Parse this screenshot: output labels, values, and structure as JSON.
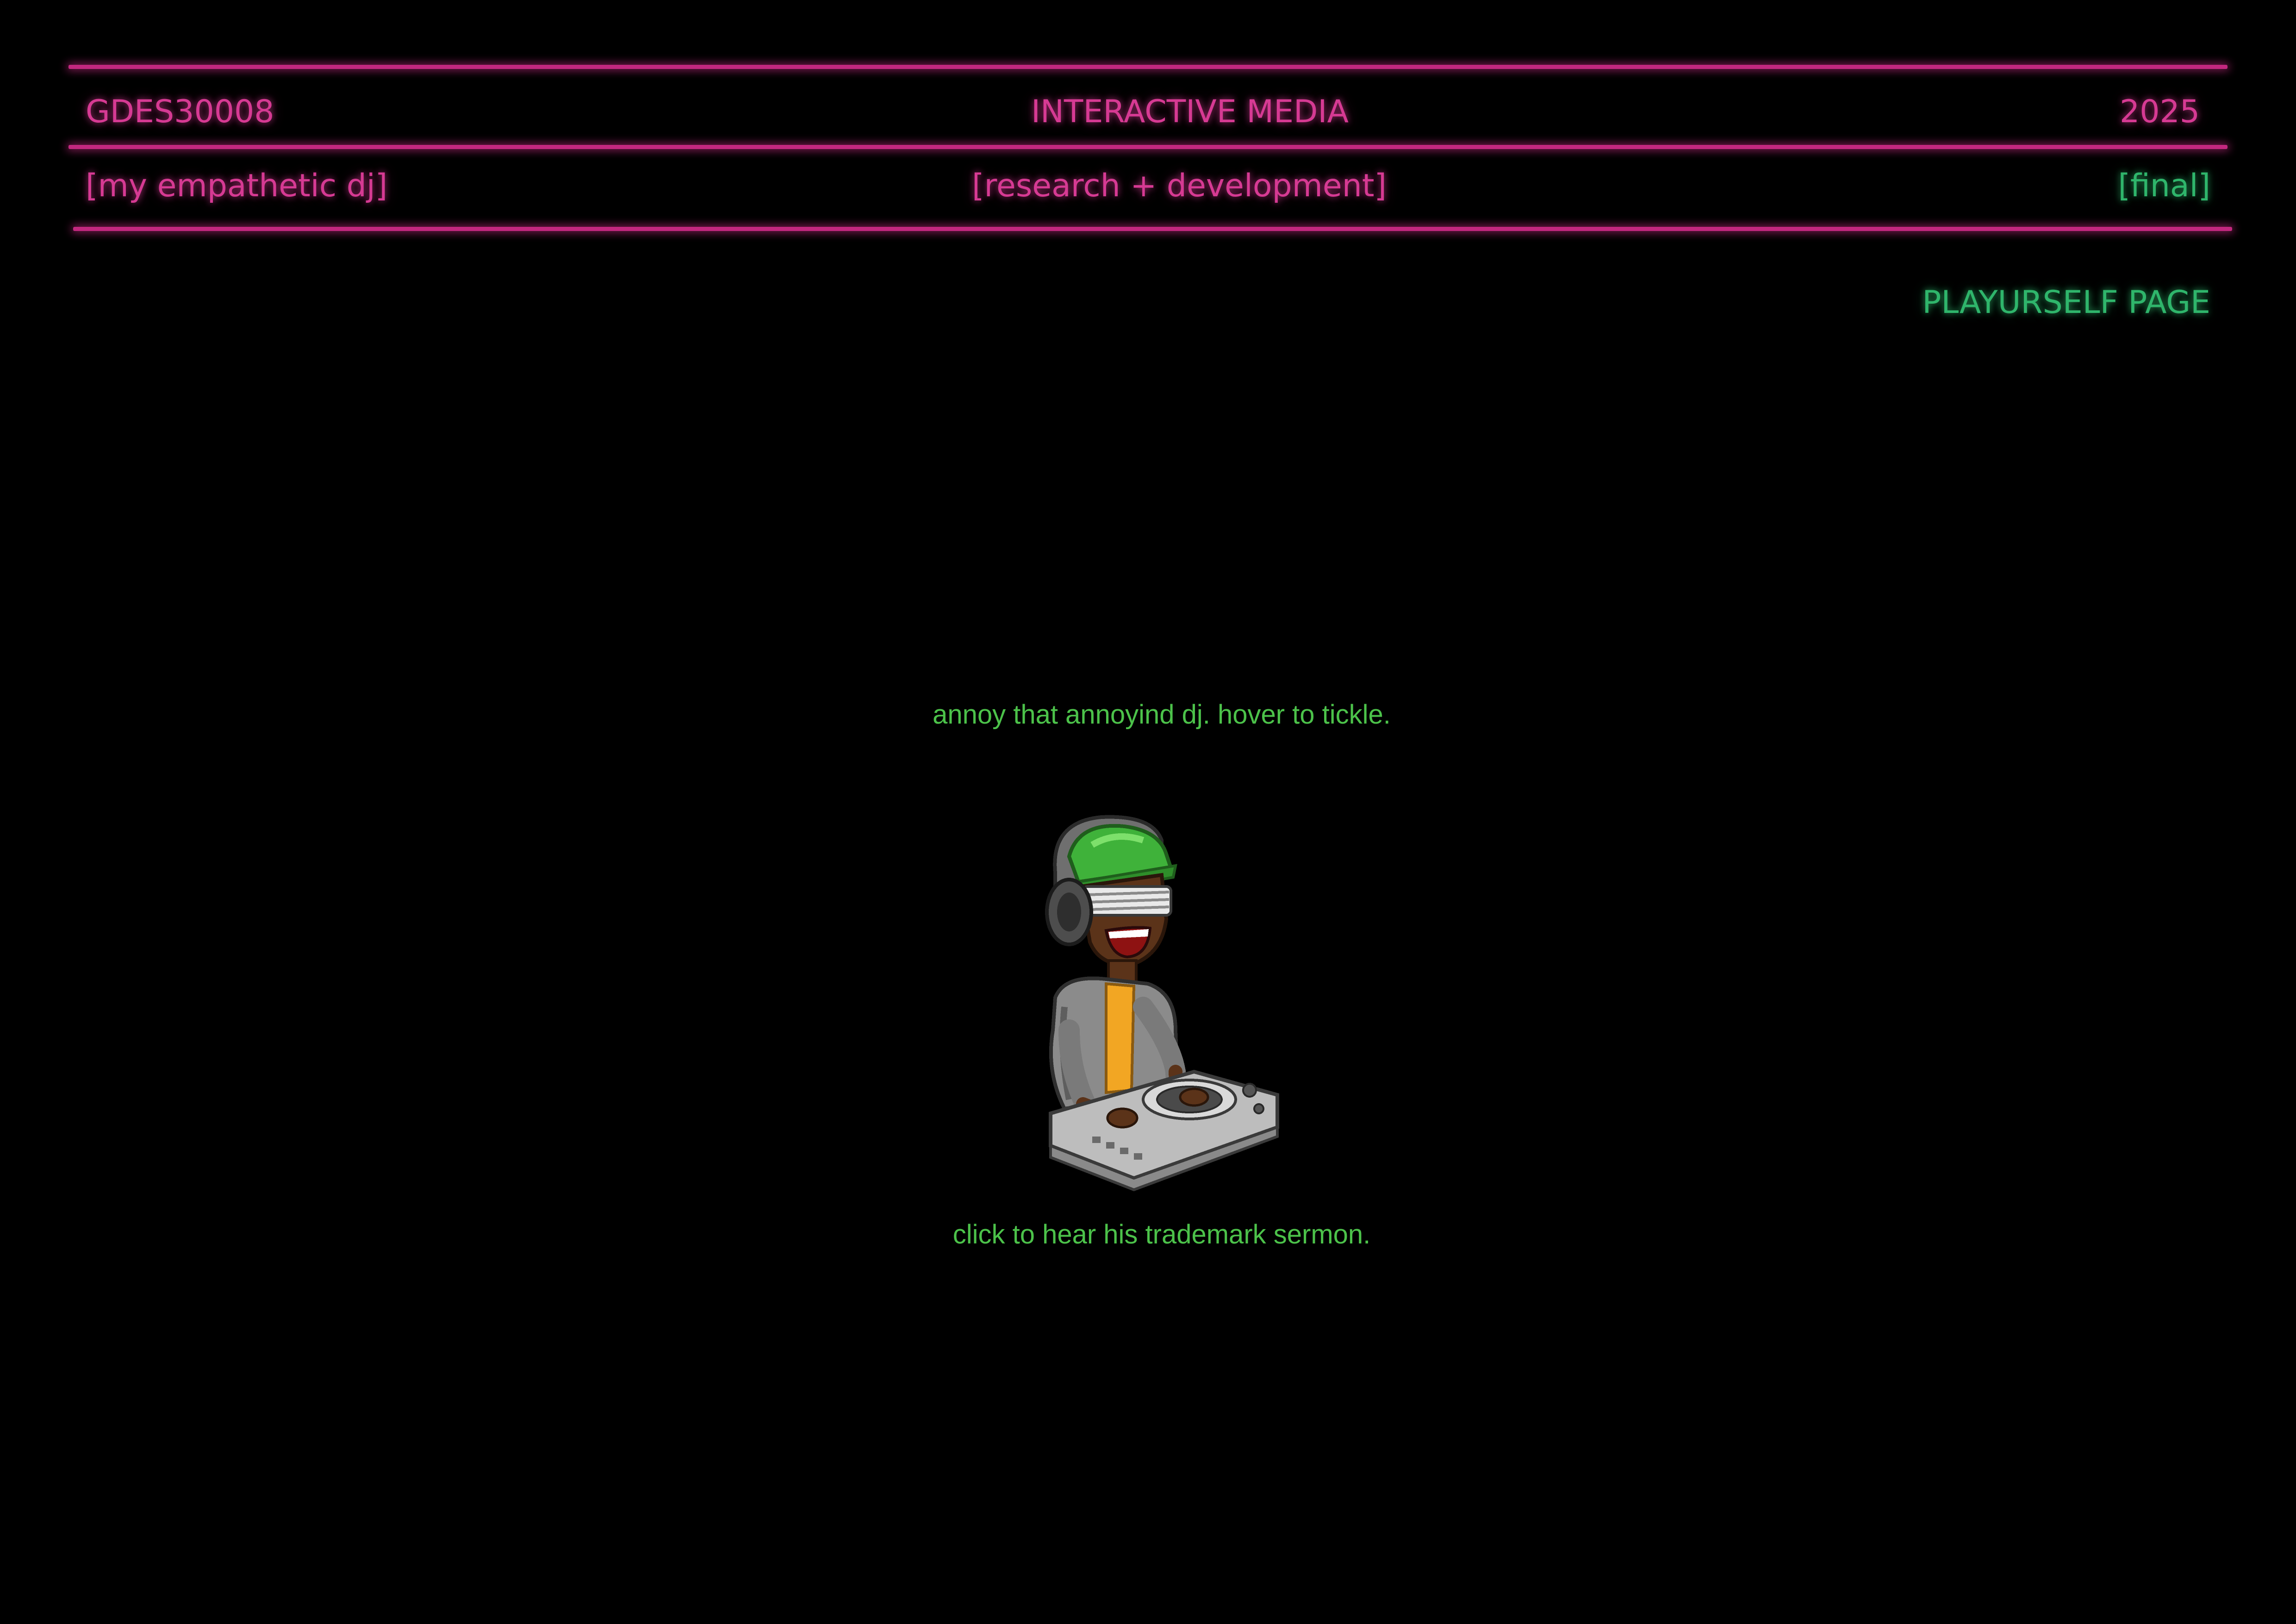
{
  "header": {
    "course_code": "GDES30008",
    "course_name": "INTERACTIVE MEDIA",
    "year": "2025",
    "project_title": "[my empathetic dj]",
    "phase": "[research + development]",
    "status": "[final]"
  },
  "nav": {
    "playurself_label": "PLAYURSELF PAGE"
  },
  "main": {
    "hover_instruction": "annoy that annoyind dj. hover to tickle.",
    "click_instruction": "click to hear his trademark sermon.",
    "character_icon": "dj-character-icon"
  },
  "colors": {
    "background": "#000000",
    "neon_pink": "#d63a93",
    "neon_green": "#2fb56b",
    "caption_green": "#4cc24a"
  }
}
